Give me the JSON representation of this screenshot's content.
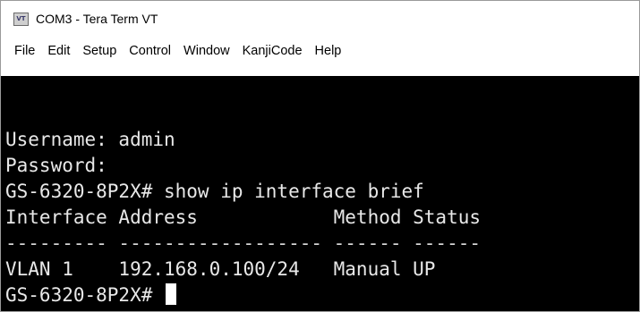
{
  "window": {
    "title": "COM3 - Tera Term VT",
    "app_icon_label": "VT"
  },
  "menu": {
    "items": [
      "File",
      "Edit",
      "Setup",
      "Control",
      "Window",
      "KanjiCode",
      "Help"
    ]
  },
  "terminal": {
    "lines": [
      "Username: admin",
      "Password:",
      "GS-6320-8P2X# show ip interface brief",
      "Interface Address            Method Status",
      "--------- ------------------ ------ ------",
      "VLAN 1    192.168.0.100/24   Manual UP"
    ],
    "prompt": "GS-6320-8P2X# "
  }
}
